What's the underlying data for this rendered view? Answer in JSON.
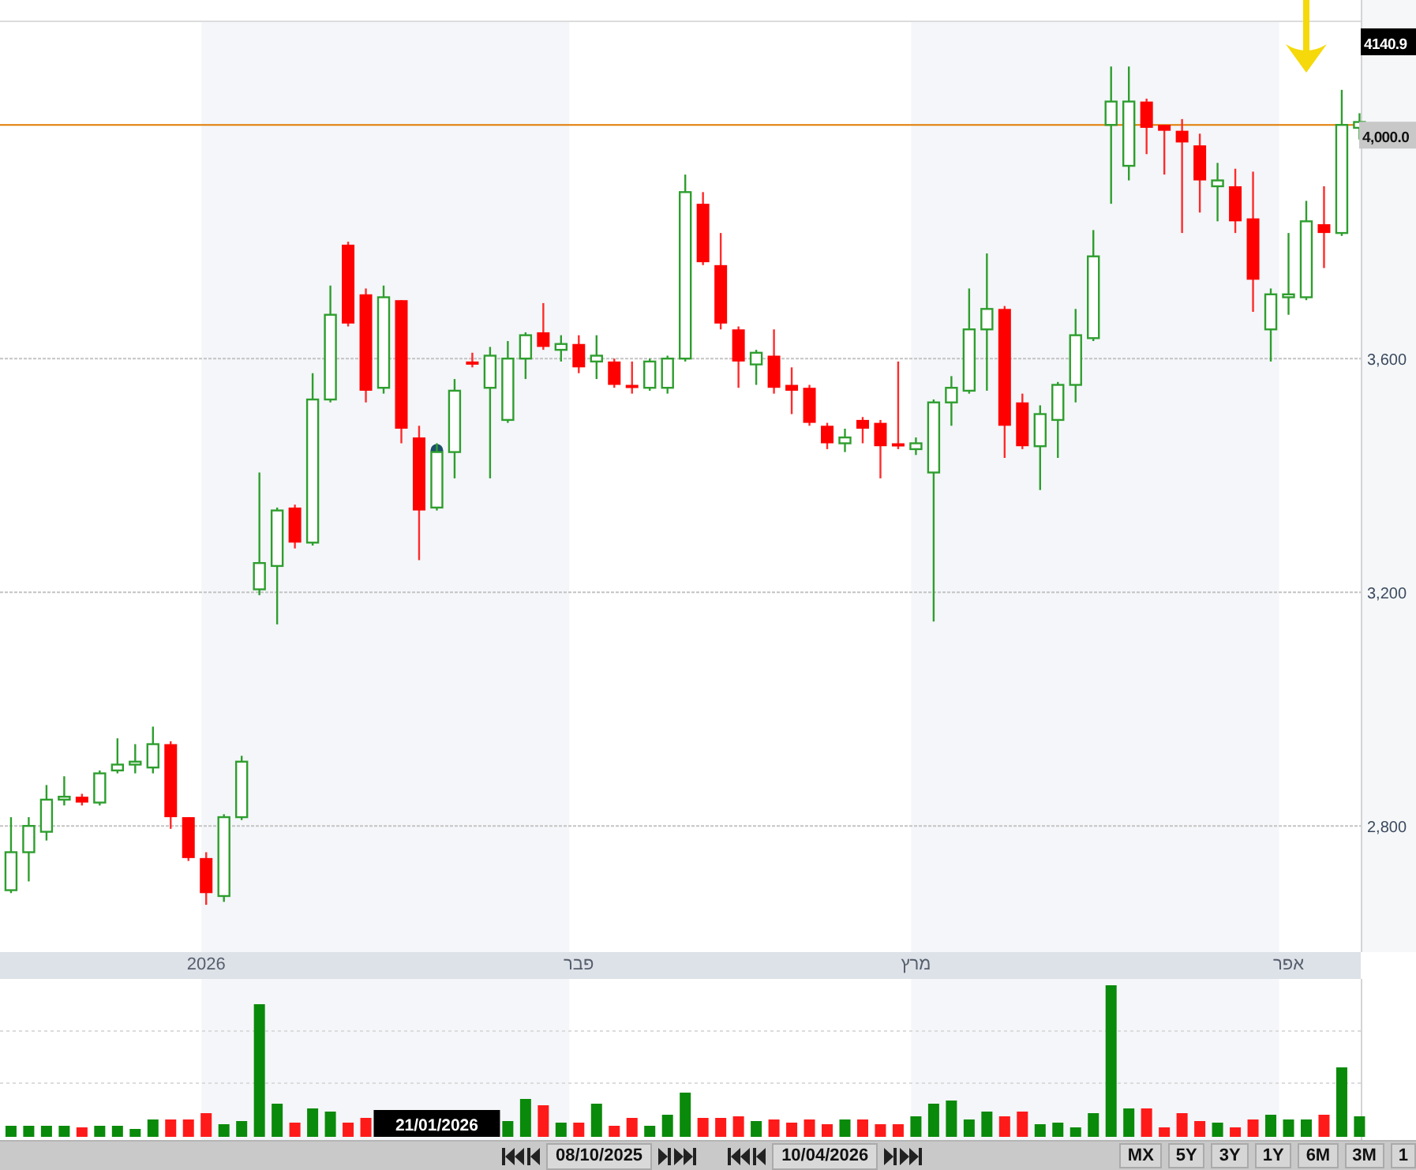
{
  "chart": {
    "chart_data": {
      "type": "candlestick",
      "categories": [
        null,
        null,
        null,
        null,
        null,
        null,
        null,
        null,
        null,
        null,
        null,
        "2026",
        null,
        null,
        null,
        null,
        null,
        null,
        null,
        null,
        null,
        null,
        null,
        null,
        null,
        null,
        null,
        null,
        null,
        null,
        null,
        null,
        "פבר",
        null,
        null,
        null,
        null,
        null,
        null,
        null,
        null,
        null,
        null,
        null,
        null,
        null,
        null,
        null,
        null,
        null,
        null,
        "מרץ",
        null,
        null,
        null,
        null,
        null,
        null,
        null,
        null,
        null,
        null,
        null,
        null,
        null,
        null,
        null,
        null,
        null,
        null,
        null,
        null,
        "אפר",
        null,
        null,
        null,
        null
      ],
      "ylim": [
        2584,
        4176
      ],
      "yticks": [
        {
          "value": 2800,
          "label": "2,800"
        },
        {
          "value": 3200,
          "label": "3,200"
        },
        {
          "value": 3600,
          "label": "3,600"
        }
      ],
      "series": [
        {
          "ohlc": [
            [
              2690,
              2815,
              2685,
              2755
            ],
            [
              2755,
              2815,
              2705,
              2800
            ],
            [
              2790,
              2870,
              2775,
              2845
            ],
            [
              2845,
              2885,
              2835,
              2850
            ],
            [
              2850,
              2855,
              2835,
              2840
            ],
            [
              2840,
              2895,
              2835,
              2890
            ],
            [
              2895,
              2950,
              2890,
              2905
            ],
            [
              2905,
              2940,
              2890,
              2910
            ],
            [
              2900,
              2970,
              2890,
              2940
            ],
            [
              2940,
              2945,
              2795,
              2815
            ],
            [
              2815,
              2815,
              2740,
              2745
            ],
            [
              2745,
              2755,
              2665,
              2685
            ],
            [
              2680,
              2820,
              2670,
              2815
            ],
            [
              2815,
              2920,
              2810,
              2910
            ],
            [
              3205,
              3405,
              3195,
              3250
            ],
            [
              3245,
              3345,
              3145,
              3340
            ],
            [
              3345,
              3350,
              3275,
              3285
            ],
            [
              3285,
              3575,
              3280,
              3530
            ],
            [
              3530,
              3725,
              3525,
              3675
            ],
            [
              3795,
              3800,
              3655,
              3660
            ],
            [
              3710,
              3720,
              3525,
              3545
            ],
            [
              3550,
              3725,
              3540,
              3705
            ],
            [
              3700,
              3700,
              3455,
              3480
            ],
            [
              3465,
              3485,
              3255,
              3340
            ],
            [
              3345,
              3455,
              3340,
              3440
            ],
            [
              3440,
              3565,
              3395,
              3545
            ],
            [
              3595,
              3610,
              3585,
              3590
            ],
            [
              3550,
              3620,
              3395,
              3605
            ],
            [
              3495,
              3630,
              3490,
              3600
            ],
            [
              3600,
              3645,
              3565,
              3640
            ],
            [
              3645,
              3695,
              3615,
              3620
            ],
            [
              3615,
              3640,
              3595,
              3625
            ],
            [
              3625,
              3640,
              3575,
              3585
            ],
            [
              3595,
              3640,
              3565,
              3605
            ],
            [
              3595,
              3600,
              3550,
              3555
            ],
            [
              3555,
              3595,
              3540,
              3550
            ],
            [
              3550,
              3600,
              3545,
              3595
            ],
            [
              3550,
              3605,
              3540,
              3600
            ],
            [
              3600,
              3915,
              3595,
              3885
            ],
            [
              3865,
              3885,
              3760,
              3765
            ],
            [
              3760,
              3815,
              3650,
              3660
            ],
            [
              3650,
              3655,
              3550,
              3595
            ],
            [
              3590,
              3615,
              3555,
              3610
            ],
            [
              3605,
              3650,
              3540,
              3550
            ],
            [
              3555,
              3585,
              3505,
              3545
            ],
            [
              3550,
              3555,
              3485,
              3490
            ],
            [
              3485,
              3490,
              3445,
              3455
            ],
            [
              3455,
              3480,
              3440,
              3465
            ],
            [
              3495,
              3500,
              3455,
              3480
            ],
            [
              3490,
              3495,
              3395,
              3450
            ],
            [
              3455,
              3595,
              3445,
              3450
            ],
            [
              3445,
              3465,
              3435,
              3455
            ],
            [
              3405,
              3530,
              3150,
              3525
            ],
            [
              3525,
              3570,
              3485,
              3550
            ],
            [
              3545,
              3720,
              3540,
              3650
            ],
            [
              3650,
              3780,
              3545,
              3685
            ],
            [
              3685,
              3690,
              3430,
              3485
            ],
            [
              3525,
              3540,
              3445,
              3450
            ],
            [
              3450,
              3520,
              3375,
              3505
            ],
            [
              3495,
              3560,
              3430,
              3555
            ],
            [
              3555,
              3685,
              3525,
              3640
            ],
            [
              3635,
              3820,
              3630,
              3775
            ],
            [
              4000,
              4100,
              3865,
              4040
            ],
            [
              3930,
              4100,
              3905,
              4040
            ],
            [
              4040,
              4045,
              3950,
              3995
            ],
            [
              4000,
              4000,
              3915,
              3990
            ],
            [
              3990,
              4010,
              3815,
              3970
            ],
            [
              3965,
              3985,
              3850,
              3905
            ],
            [
              3895,
              3935,
              3835,
              3905
            ],
            [
              3895,
              3925,
              3815,
              3835
            ],
            [
              3840,
              3920,
              3680,
              3735
            ],
            [
              3650,
              3720,
              3595,
              3710
            ],
            [
              3705,
              3815,
              3675,
              3710
            ],
            [
              3705,
              3870,
              3700,
              3835
            ],
            [
              3830,
              3895,
              3755,
              3815
            ],
            [
              3815,
              4060,
              3810,
              4000
            ],
            [
              3995,
              4020,
              3975,
              4005
            ]
          ]
        }
      ],
      "grid": true,
      "ref_lines": [
        {
          "axis": "y",
          "value": 4000,
          "label": "4,000.0",
          "color": "#e07b00"
        }
      ],
      "annotations": [
        {
          "text": "4140.9",
          "y": 4140.9
        }
      ]
    },
    "crosshair": {
      "label": "21/01/2026"
    }
  },
  "toolbar": {
    "start_date": "08/10/2025",
    "end_date": "10/04/2026",
    "ranges": [
      {
        "label": "MX"
      },
      {
        "label": "5Y"
      },
      {
        "label": "3Y"
      },
      {
        "label": "1Y"
      },
      {
        "label": "6M"
      },
      {
        "label": "3M"
      },
      {
        "label": "1"
      }
    ]
  }
}
